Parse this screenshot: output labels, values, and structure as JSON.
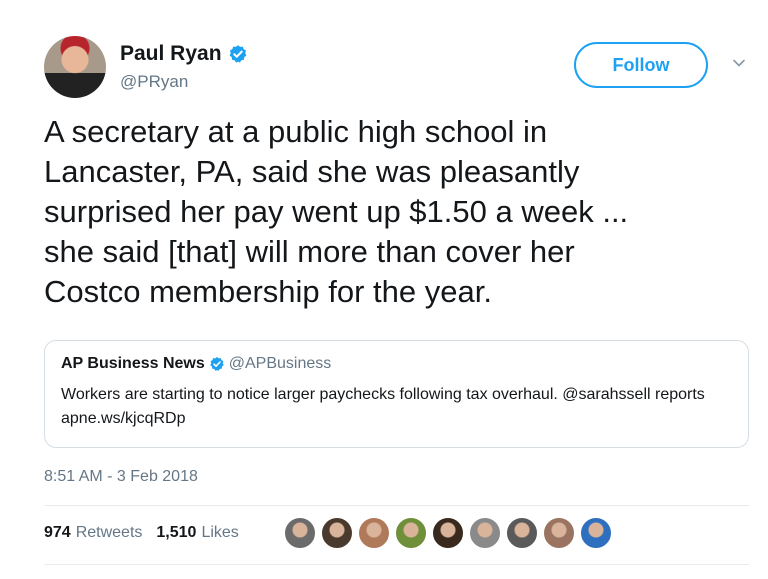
{
  "author": {
    "name": "Paul Ryan",
    "handle": "@PRyan",
    "verified": true
  },
  "follow_label": "Follow",
  "tweet_text": "A secretary at a public high school in\nLancaster, PA, said she was pleasantly\nsurprised her pay went up $1.50 a week ...\nshe said [that] will more than cover her\nCostco membership for the year.",
  "quoted_tweet": {
    "name": "AP Business News",
    "handle": "@APBusiness",
    "verified": true,
    "text": "Workers are starting to notice larger paychecks following tax overhaul. @sarahssell reports apne.ws/kjcqRDp"
  },
  "timestamp": "8:51 AM - 3 Feb 2018",
  "stats": {
    "retweets_count": "974",
    "retweets_label": "Retweets",
    "likes_count": "1,510",
    "likes_label": "Likes"
  },
  "likers": [
    {
      "color": "#6b6b6b"
    },
    {
      "color": "#4a3a2e"
    },
    {
      "color": "#b07a5a"
    },
    {
      "color": "#6f8f3a"
    },
    {
      "color": "#3a2a1e"
    },
    {
      "color": "#8a8a8a"
    },
    {
      "color": "#5a5a5a"
    },
    {
      "color": "#9a7460"
    },
    {
      "color": "#2f6fbf"
    }
  ],
  "colors": {
    "brand_blue": "#1da1f2",
    "muted_gray": "#657786"
  }
}
